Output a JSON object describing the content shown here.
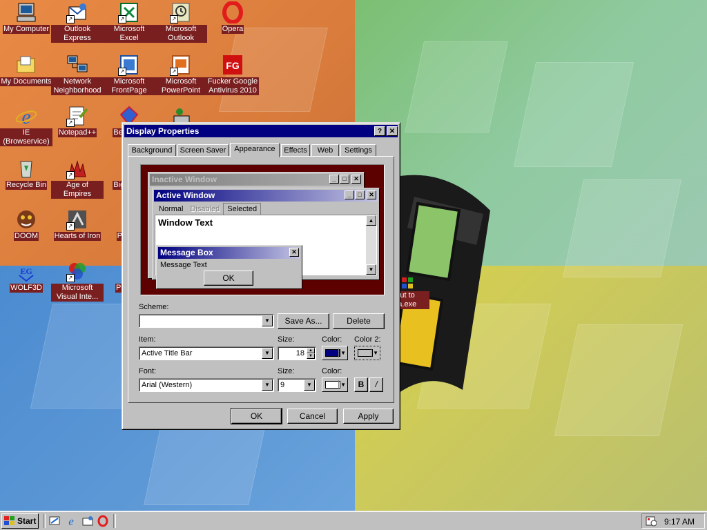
{
  "desktop": {
    "icons": [
      {
        "label": "My Computer"
      },
      {
        "label": "Outlook Express"
      },
      {
        "label": "Microsoft Excel"
      },
      {
        "label": "Microsoft Outlook"
      },
      {
        "label": "Opera"
      },
      {
        "label": "My Documents"
      },
      {
        "label": "Network Neighborhood"
      },
      {
        "label": "Microsoft FrontPage"
      },
      {
        "label": "Microsoft PowerPoint"
      },
      {
        "label": "Fucker Google Antivirus 2010"
      },
      {
        "label": "IE (Browservice)"
      },
      {
        "label": "Notepad++"
      },
      {
        "label": "Bej... D..."
      },
      {
        "label": "Recycle Bin"
      },
      {
        "label": "Age of Empires"
      },
      {
        "label": "Big... D..."
      },
      {
        "label": "DOOM"
      },
      {
        "label": "Hearts of Iron"
      },
      {
        "label": "Pegg..."
      },
      {
        "label": "WOLF3D"
      },
      {
        "label": "Microsoft Visual Inte..."
      },
      {
        "label": "Pl... Z..."
      },
      {
        "label": "ortcut to data.exe"
      }
    ]
  },
  "dialog": {
    "title": "Display Properties",
    "help_button": "?",
    "close_button": "✕",
    "tabs": [
      "Background",
      "Screen Saver",
      "Appearance",
      "Effects",
      "Web",
      "Settings"
    ],
    "active_tab": "Appearance",
    "preview": {
      "inactive_title": "Inactive Window",
      "active_title": "Active Window",
      "menu_normal": "Normal",
      "menu_disabled": "Disabled",
      "menu_selected": "Selected",
      "window_text": "Window Text",
      "msgbox_title": "Message Box",
      "msgbox_text": "Message Text",
      "msgbox_ok": "OK"
    },
    "scheme_label": "Scheme:",
    "scheme_value": "",
    "save_as": "Save As...",
    "delete": "Delete",
    "item_label": "Item:",
    "item_value": "Active Title Bar",
    "size_label": "Size:",
    "item_size": "18",
    "color_label": "Color:",
    "color2_label": "Color 2:",
    "font_label": "Font:",
    "font_value": "Arial (Western)",
    "font_size_label": "Size:",
    "font_size": "9",
    "font_color_label": "Color:",
    "bold": "B",
    "italic": "/",
    "ok": "OK",
    "cancel": "Cancel",
    "apply": "Apply",
    "colors": {
      "title_active": "#000080",
      "color2": "#c0c0c0",
      "font_color": "#ffffff"
    }
  },
  "taskbar": {
    "start": "Start",
    "clock": "9:17 AM"
  }
}
